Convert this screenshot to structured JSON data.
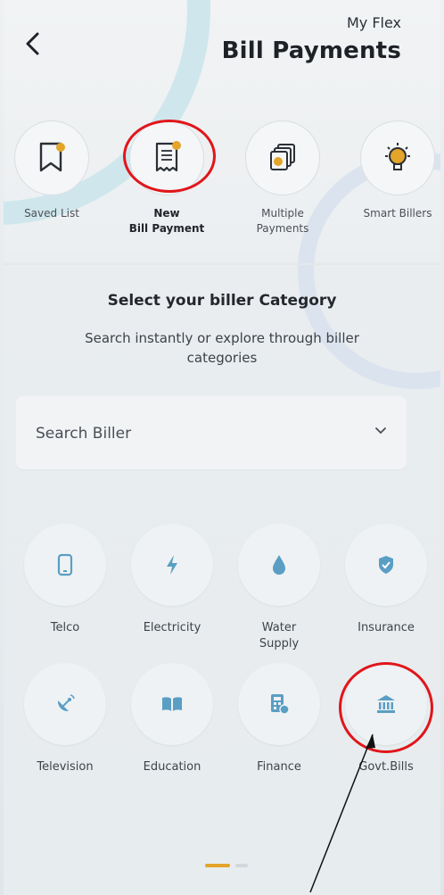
{
  "header": {
    "brand": "My Flex",
    "title": "Bill Payments"
  },
  "quick_actions": [
    {
      "label": "Saved List",
      "icon": "bookmark-icon"
    },
    {
      "label": "New\nBill Payment",
      "icon": "receipt-icon"
    },
    {
      "label": "Multiple\nPayments",
      "icon": "stacked-cards-icon"
    },
    {
      "label": "Smart Billers",
      "icon": "lightbulb-icon"
    }
  ],
  "section": {
    "title": "Select your biller Category",
    "subtitle": "Search instantly or explore through biller categories"
  },
  "search": {
    "placeholder": "Search Biller"
  },
  "categories": [
    {
      "label": "Telco",
      "icon": "phone-icon"
    },
    {
      "label": "Electricity",
      "icon": "lightning-icon"
    },
    {
      "label": "Water\nSupply",
      "icon": "water-drop-icon"
    },
    {
      "label": "Insurance",
      "icon": "shield-check-icon"
    },
    {
      "label": "Television",
      "icon": "satellite-dish-icon"
    },
    {
      "label": "Education",
      "icon": "book-icon"
    },
    {
      "label": "Finance",
      "icon": "calculator-icon"
    },
    {
      "label": "Govt.Bills",
      "icon": "bank-building-icon"
    }
  ],
  "colors": {
    "accent": "#e3a52a",
    "icon_blue": "#5a9ec4",
    "highlight_red": "#e0161b"
  }
}
